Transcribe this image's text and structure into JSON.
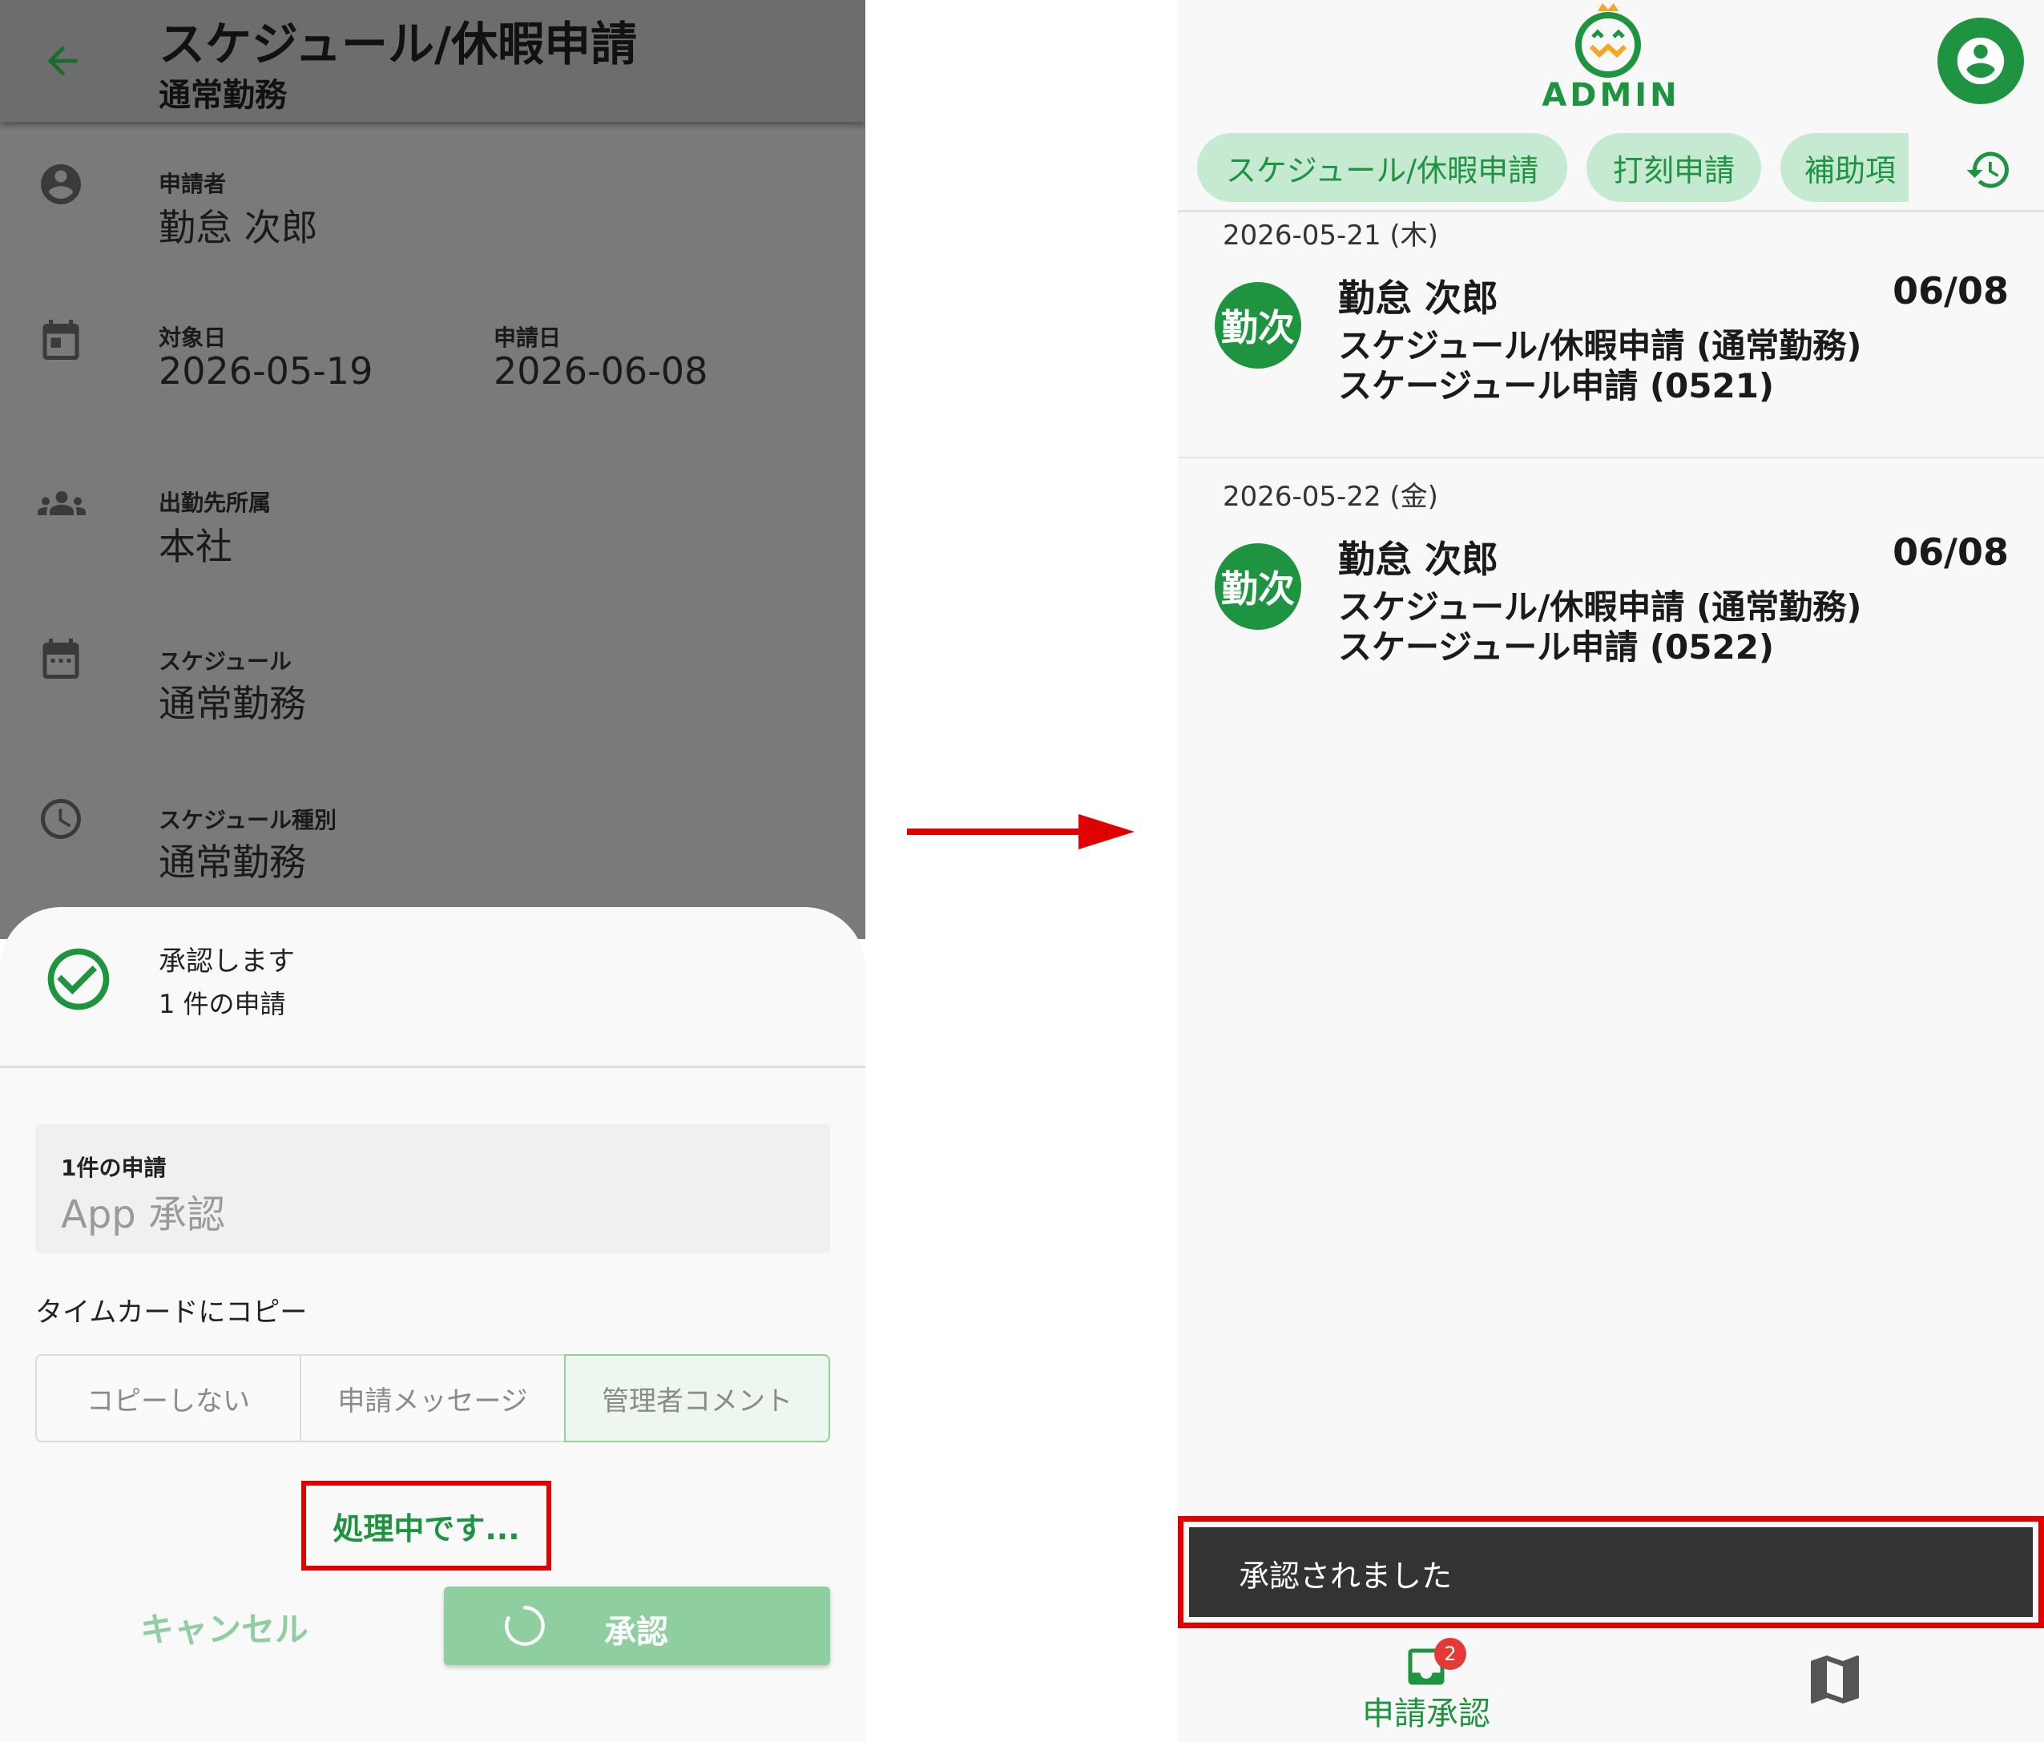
{
  "left": {
    "appbar": {
      "title": "スケジュール/休暇申請",
      "subtitle": "通常勤務"
    },
    "details": {
      "applicant": {
        "label": "申請者",
        "value": "勤怠 次郎",
        "icon": "person-icon"
      },
      "target_date": {
        "label": "対象日",
        "value": "2026-05-19",
        "icon": "calendar-icon"
      },
      "request_date": {
        "label": "申請日",
        "value": "2026-06-08"
      },
      "department": {
        "label": "出勤先所属",
        "value": "本社",
        "icon": "group-icon"
      },
      "schedule": {
        "label": "スケジュール",
        "value": "通常勤務",
        "icon": "calendar-dots-icon"
      },
      "schedule_type": {
        "label": "スケジュール種別",
        "value": "通常勤務",
        "icon": "clock-icon"
      }
    },
    "sheet": {
      "title": "承認します",
      "count": "1 件の申請",
      "field_label": "1件の申請",
      "field_value": "App 承認",
      "copy_label": "タイムカードにコピー",
      "segments": [
        {
          "label": "コピーしない"
        },
        {
          "label": "申請メッセージ"
        },
        {
          "label": "管理者コメント"
        }
      ],
      "selected_segment": "管理者コメント",
      "processing": "処理中です...",
      "cancel": "キャンセル",
      "approve": "承認"
    }
  },
  "right": {
    "logo_text": "ADMIN",
    "tabs": [
      {
        "label": "スケジュール/休暇申請"
      },
      {
        "label": "打刻申請"
      },
      {
        "label": "補助項"
      }
    ],
    "groups": [
      {
        "date": "2026-05-21 (木)",
        "items": [
          {
            "avatar": "勤次",
            "name": "勤怠 次郎",
            "line1": "スケジュール/休暇申請 (通常勤務)",
            "line2": "スケージュール申請 (0521)",
            "date": "06/08"
          }
        ]
      },
      {
        "date": "2026-05-22 (金)",
        "items": [
          {
            "avatar": "勤次",
            "name": "勤怠 次郎",
            "line1": "スケジュール/休暇申請 (通常勤務)",
            "line2": "スケージュール申請 (0522)",
            "date": "06/08"
          }
        ]
      }
    ],
    "snackbar": "承認されました",
    "nav": {
      "approval_label": "申請承認",
      "approval_badge": "2",
      "map_icon": "map-icon"
    }
  },
  "colors": {
    "brand_green": "#1e9440",
    "chip_bg": "#c5ead1",
    "highlight_red": "#e00000",
    "snackbar_bg": "#333333"
  }
}
